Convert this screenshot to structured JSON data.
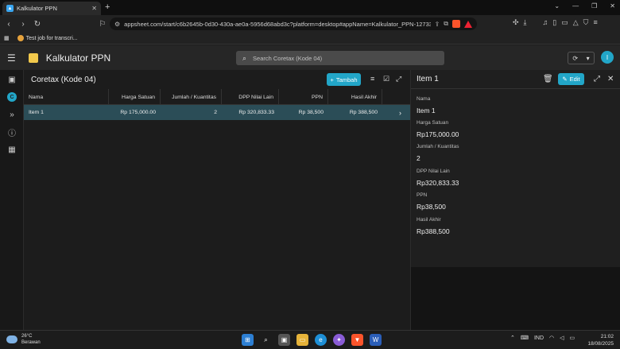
{
  "browser": {
    "tab_title": "Kalkulator PPN",
    "url": "appsheet.com/start/c6b2645b-0d30-430a-ae0a-5956d68abd3c?platform=desktop#appName=Kalkulator_PPN-127330770...",
    "bookmark": "Test job for transcri..."
  },
  "app": {
    "title": "Kalkulator PPN",
    "search_placeholder": "Search Coretax (Kode 04)",
    "avatar_initial": "I"
  },
  "table": {
    "title": "Coretax (Kode 04)",
    "add_label": "Tambah",
    "columns": [
      "Nama",
      "Harga Satuan",
      "Jumlah / Kuantitas",
      "DPP Nilai Lain",
      "PPN",
      "Hasil Akhir"
    ],
    "rows": [
      [
        "Item 1",
        "Rp 175,000.00",
        "2",
        "Rp 320,833.33",
        "Rp 38,500",
        "Rp 388,500"
      ]
    ]
  },
  "detail": {
    "title": "Item 1",
    "edit_label": "Edit",
    "fields": [
      {
        "label": "Nama",
        "value": "Item 1"
      },
      {
        "label": "Harga Satuan",
        "value": "Rp175,000.00"
      },
      {
        "label": "Jumlah / Kuantitas",
        "value": "2"
      },
      {
        "label": "DPP Nilai Lain",
        "value": "Rp320,833.33"
      },
      {
        "label": "PPN",
        "value": "Rp38,500"
      },
      {
        "label": "Hasil Akhir",
        "value": "Rp388,500"
      }
    ]
  },
  "taskbar": {
    "temp": "26°C",
    "weather": "Berawan",
    "lang": "IND",
    "time": "21:02",
    "date": "18/08/2025"
  },
  "colors": {
    "accent": "#22a6c8",
    "selected_row": "#2b4d57"
  }
}
